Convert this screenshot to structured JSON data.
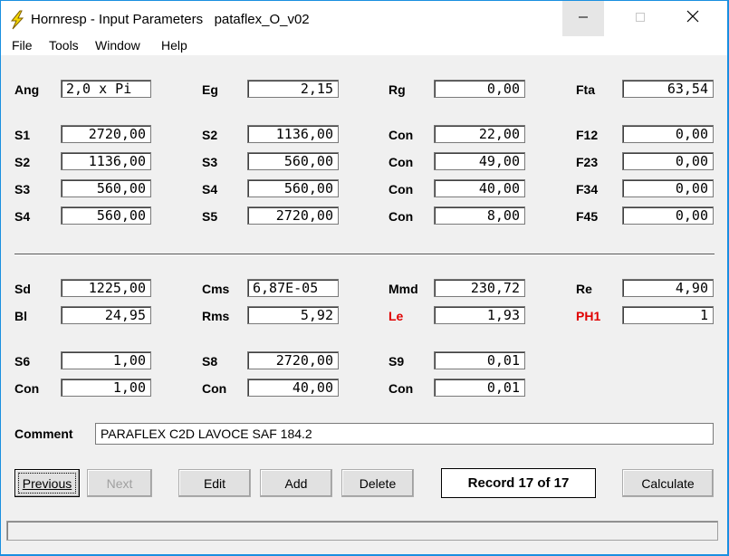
{
  "window": {
    "title": "Hornresp - Input Parameters   pataflex_O_v02",
    "minimize_icon": "minimize-icon",
    "maximize_icon": "maximize-icon",
    "close_icon": "close-icon",
    "app_icon": "lightning-bolt-icon"
  },
  "menu": [
    "File",
    "Tools",
    "Window",
    "Help"
  ],
  "top": {
    "ang_label": "Ang",
    "ang_value": "2,0 x Pi",
    "eg_label": "Eg",
    "eg_value": "2,15",
    "rg_label": "Rg",
    "rg_value": "0,00",
    "fta_label": "Fta",
    "fta_value": "63,54"
  },
  "sections": [
    {
      "c1": "S1",
      "v1": "2720,00",
      "c2": "S2",
      "v2": "1136,00",
      "c3": "Con",
      "v3": "22,00",
      "c4": "F12",
      "v4": "0,00"
    },
    {
      "c1": "S2",
      "v1": "1136,00",
      "c2": "S3",
      "v2": "560,00",
      "c3": "Con",
      "v3": "49,00",
      "c4": "F23",
      "v4": "0,00"
    },
    {
      "c1": "S3",
      "v1": "560,00",
      "c2": "S4",
      "v2": "560,00",
      "c3": "Con",
      "v3": "40,00",
      "c4": "F34",
      "v4": "0,00"
    },
    {
      "c1": "S4",
      "v1": "560,00",
      "c2": "S5",
      "v2": "2720,00",
      "c3": "Con",
      "v3": "8,00",
      "c4": "F45",
      "v4": "0,00"
    }
  ],
  "driver": {
    "sd_label": "Sd",
    "sd_value": "1225,00",
    "cms_label": "Cms",
    "cms_value": "6,87E-05",
    "mmd_label": "Mmd",
    "mmd_value": "230,72",
    "re_label": "Re",
    "re_value": "4,90",
    "bl_label": "Bl",
    "bl_value": "24,95",
    "rms_label": "Rms",
    "rms_value": "5,92",
    "le_label": "Le",
    "le_value": "1,93",
    "ph1_label": "PH1",
    "ph1_value": "1"
  },
  "chambers": {
    "s6_label": "S6",
    "s6_value": "1,00",
    "s8_label": "S8",
    "s8_value": "2720,00",
    "s9_label": "S9",
    "s9_value": "0,01",
    "con1_label": "Con",
    "con1_value": "1,00",
    "con2_label": "Con",
    "con2_value": "40,00",
    "con3_label": "Con",
    "con3_value": "0,01"
  },
  "comment": {
    "label": "Comment",
    "value": "PARAFLEX C2D LAVOCE SAF 184.2"
  },
  "buttons": {
    "previous": "Previous",
    "next": "Next",
    "edit": "Edit",
    "add": "Add",
    "delete": "Delete",
    "calculate": "Calculate"
  },
  "record": "Record 17 of 17",
  "colors": {
    "red_label": "#e00000",
    "desktop": "#1a8fe0"
  }
}
